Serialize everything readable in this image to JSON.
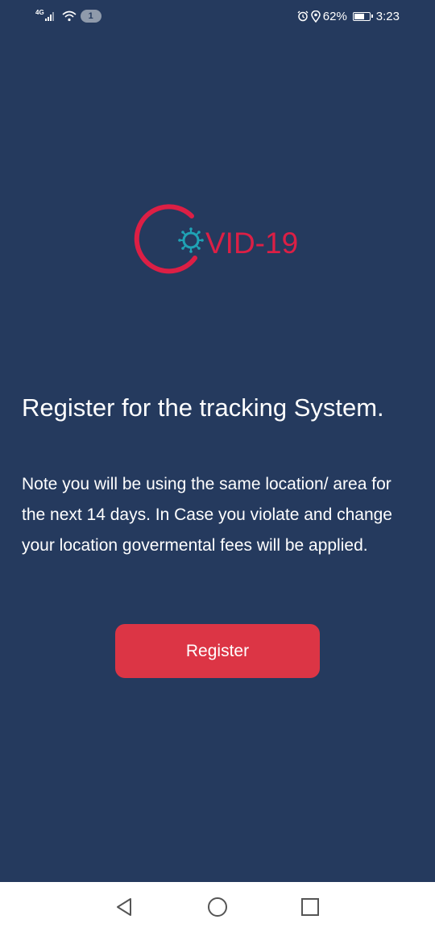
{
  "status_bar": {
    "network": "4G",
    "notification_count": "1",
    "battery": "62%",
    "time": "3:23",
    "icons": [
      "signal-icon",
      "wifi-icon",
      "alarm-icon",
      "location-icon",
      "battery-icon"
    ]
  },
  "logo": {
    "text": "VID-19",
    "full_text": "COVID-19",
    "primary_color": "#dc1f45",
    "virus_color": "#1fa3b5"
  },
  "main": {
    "heading": "Register for the tracking System.",
    "note": "Note you will be using the same location/ area for the next 14 days. In Case you violate and change your location govermental fees will be applied.",
    "register_label": "Register"
  },
  "nav": {
    "icons": [
      "back-icon",
      "home-icon",
      "recents-icon"
    ]
  },
  "colors": {
    "background": "#253a5e",
    "button": "#dc3545",
    "nav_background": "#ffffff"
  }
}
